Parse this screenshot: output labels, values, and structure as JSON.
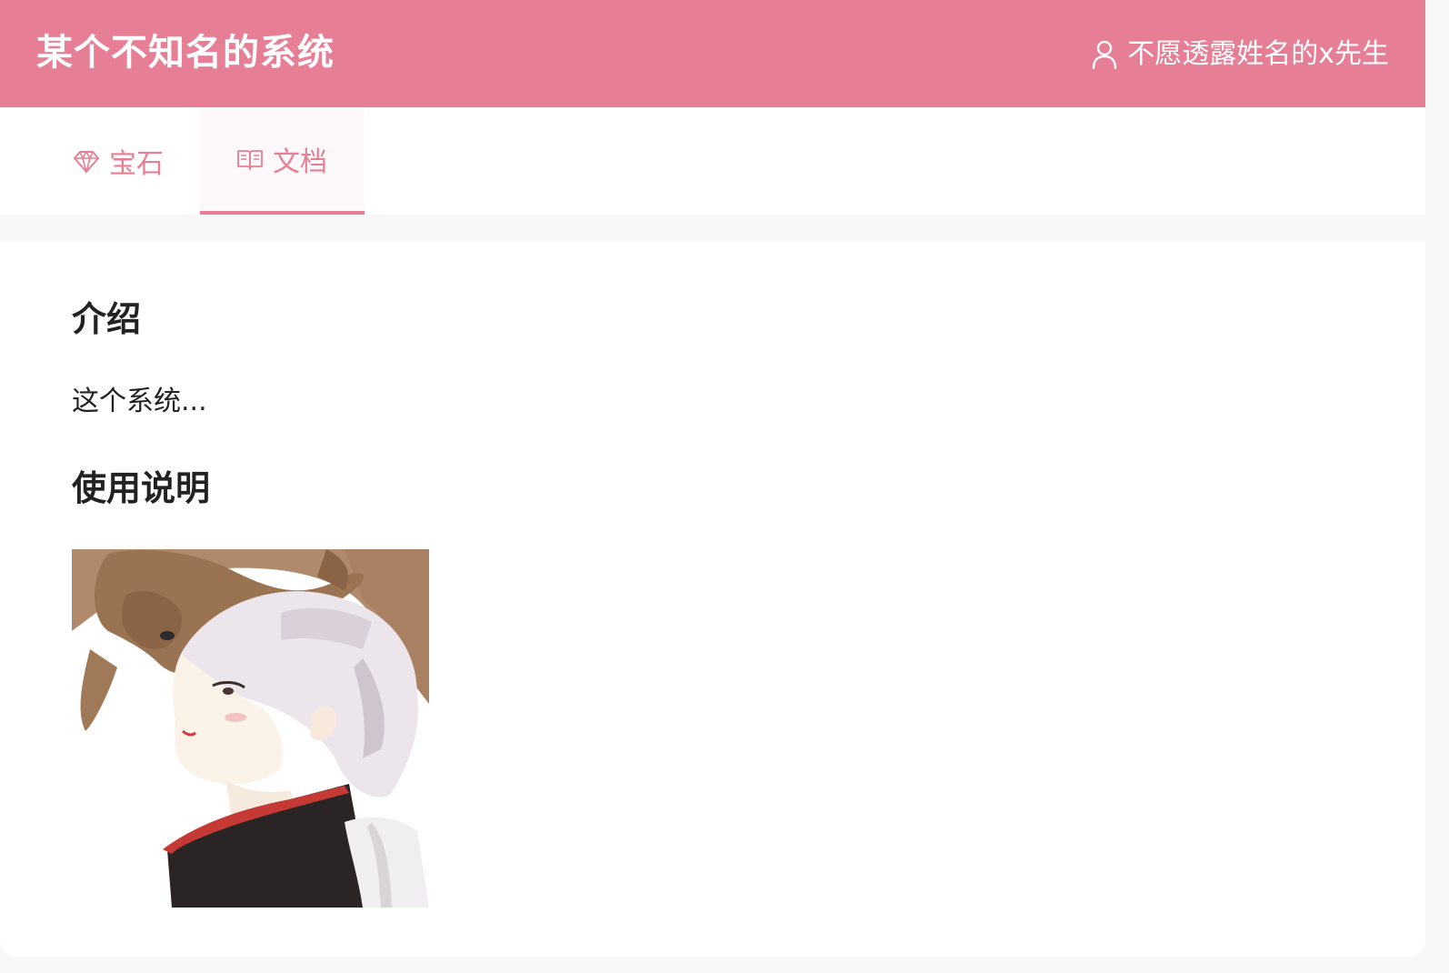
{
  "header": {
    "title": "某个不知名的系统",
    "user_name": "不愿透露姓名的x先生",
    "user_icon": "user-icon"
  },
  "tabs": [
    {
      "label": "宝石",
      "icon": "gem-icon",
      "active": false
    },
    {
      "label": "文档",
      "icon": "book-icon",
      "active": true
    }
  ],
  "content": {
    "intro_heading": "介绍",
    "intro_text": "这个系统...",
    "usage_heading": "使用说明"
  },
  "colors": {
    "brand": "#e67e95",
    "text": "#222222",
    "background": "#f7f7f7"
  }
}
